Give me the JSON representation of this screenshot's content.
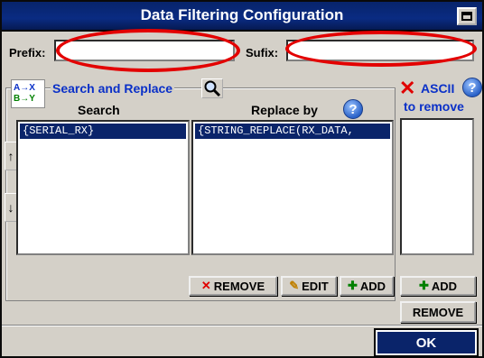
{
  "window": {
    "title": "Data Filtering Configuration"
  },
  "prefix": {
    "label": "Prefix:",
    "value": ""
  },
  "sufix": {
    "label": "Sufix:",
    "value": ""
  },
  "search_replace": {
    "group_label": "Search and Replace",
    "icon_text_a": "A→X",
    "icon_text_b": "B→Y",
    "search_header": "Search",
    "replace_header": "Replace by",
    "search_items": [
      "{SERIAL_RX}"
    ],
    "replace_items": [
      "{STRING_REPLACE(RX_DATA,"
    ],
    "remove_label": "REMOVE",
    "edit_label": "EDIT",
    "add_label": "ADD",
    "up_arrow": "↑",
    "down_arrow": "↓"
  },
  "ascii": {
    "title": "ASCII",
    "subtitle": "to remove",
    "add_label": "ADD",
    "remove_label": "REMOVE"
  },
  "help_glyph": "?",
  "ok_label": "OK",
  "colors": {
    "titlebar": "#0a2b82",
    "selection": "#0a246a",
    "link": "#0a30c8",
    "highlight_ellipse": "#e30000"
  }
}
